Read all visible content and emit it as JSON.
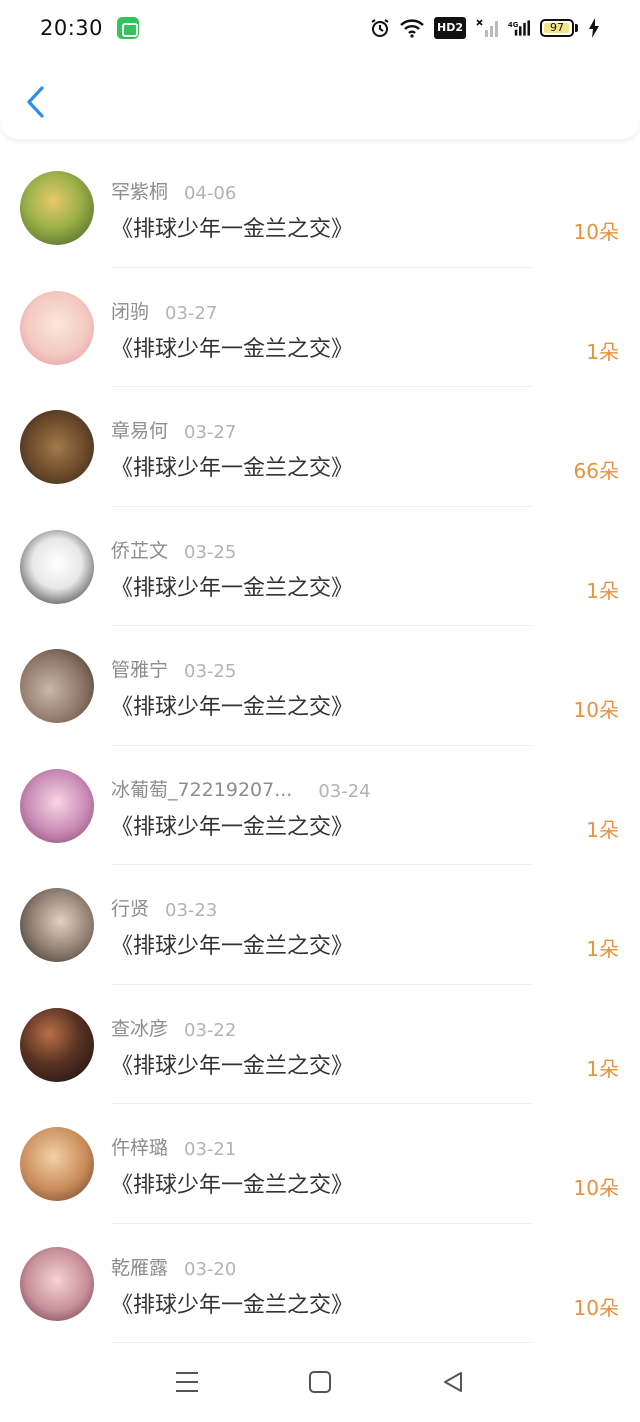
{
  "status_bar": {
    "time": "20:30",
    "hd_label": "HD2",
    "network_label": "4G",
    "battery_level": "97",
    "battery_fraction": 0.97,
    "accent_battery_color": "#f3e68a"
  },
  "header": {
    "back_icon": "chevron-left-icon",
    "back_color": "#2f8fe6"
  },
  "list": {
    "items": [
      {
        "name": "罕紫桐",
        "date": "04-06",
        "title": "《排球少年一金兰之交》",
        "flowers": "10朵"
      },
      {
        "name": "闭驹",
        "date": "03-27",
        "title": "《排球少年一金兰之交》",
        "flowers": "1朵"
      },
      {
        "name": "章易何",
        "date": "03-27",
        "title": "《排球少年一金兰之交》",
        "flowers": "66朵"
      },
      {
        "name": "侨芷文",
        "date": "03-25",
        "title": "《排球少年一金兰之交》",
        "flowers": "1朵"
      },
      {
        "name": "管雅宁",
        "date": "03-25",
        "title": "《排球少年一金兰之交》",
        "flowers": "10朵"
      },
      {
        "name": "冰葡萄_72219207...",
        "date": "03-24",
        "title": "《排球少年一金兰之交》",
        "flowers": "1朵"
      },
      {
        "name": "行贤",
        "date": "03-23",
        "title": "《排球少年一金兰之交》",
        "flowers": "1朵"
      },
      {
        "name": "查冰彦",
        "date": "03-22",
        "title": "《排球少年一金兰之交》",
        "flowers": "1朵"
      },
      {
        "name": "仵梓璐",
        "date": "03-21",
        "title": "《排球少年一金兰之交》",
        "flowers": "10朵"
      },
      {
        "name": "乾雁露",
        "date": "03-20",
        "title": "《排球少年一金兰之交》",
        "flowers": "10朵"
      }
    ]
  },
  "colors": {
    "flowers": "#e8923f",
    "name": "#8d8d8d",
    "date": "#b3b3b3",
    "title": "#333333"
  },
  "nav_bar": {
    "menu_icon": "menu-icon",
    "home_icon": "square-home-icon",
    "back_icon": "triangle-back-icon"
  }
}
